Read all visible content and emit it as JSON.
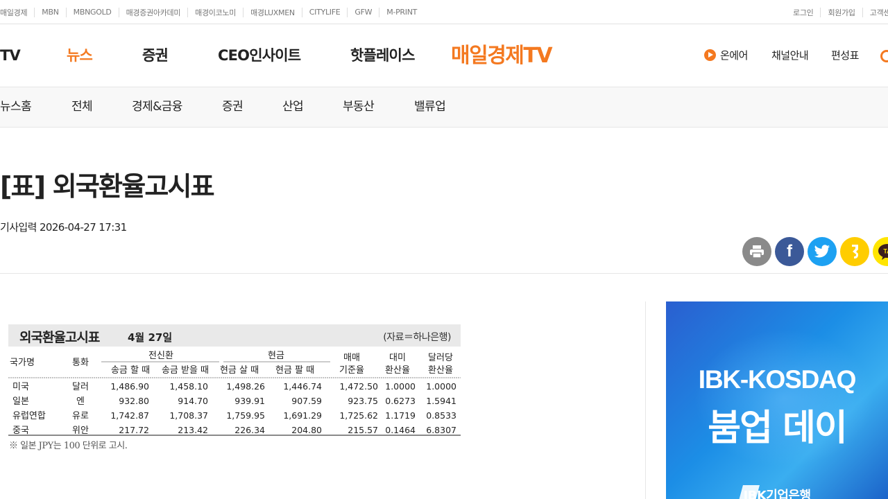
{
  "utilbar": {
    "left_links": [
      "매일경제",
      "MBN",
      "MBNGOLD",
      "매경증권아카데미",
      "매경이코노미",
      "매경LUXMEN",
      "CITYLIFE",
      "GFW",
      "M-PRINT"
    ],
    "right_links": [
      "로그인",
      "회원가입",
      "고객센터"
    ]
  },
  "header": {
    "nav": [
      "TV",
      "뉴스",
      "증권",
      "CEO인사이트",
      "핫플레이스"
    ],
    "active_nav": "뉴스",
    "logo": "매일경제TV",
    "onair": "온에어",
    "channel": "채널안내",
    "schedule": "편성표"
  },
  "subnav": [
    "뉴스홈",
    "전체",
    "경제&금융",
    "증권",
    "산업",
    "부동산",
    "밸류업"
  ],
  "article": {
    "title": "[표] 외국환율고시표",
    "date": "기사입력 2026-04-27 17:31"
  },
  "share": {
    "print_icon": "printer-icon",
    "facebook_icon": "facebook-icon",
    "twitter_icon": "twitter-icon",
    "kakaostory_icon": "kakaostory-icon",
    "kakaotalk_icon": "kakaotalk-icon",
    "talk_label": "TA"
  },
  "fx_table": {
    "title": "외국환율고시표",
    "date": "4월 27일",
    "source": "(자료＝하나은행)",
    "group_headers": {
      "telegraphic": "전신환",
      "cash": "현금"
    },
    "headers": [
      "국가명",
      "통화",
      "송금 할 때",
      "송금 받을 때",
      "현금 살 때",
      "현금 팔 때",
      "매매 기준율",
      "대미 환산율",
      "달러당 환산율"
    ],
    "rows": [
      [
        "미국",
        "달러",
        "1,486.90",
        "1,458.10",
        "1,498.26",
        "1,446.74",
        "1,472.50",
        "1.0000",
        "1.0000"
      ],
      [
        "일본",
        "엔",
        "932.80",
        "914.70",
        "939.91",
        "907.59",
        "923.75",
        "0.6273",
        "1.5941"
      ],
      [
        "유럽연합",
        "유로",
        "1,742.87",
        "1,708.37",
        "1,759.95",
        "1,691.29",
        "1,725.62",
        "1.1719",
        "0.8533"
      ],
      [
        "중국",
        "위안",
        "217.72",
        "213.42",
        "226.34",
        "204.80",
        "215.57",
        "0.1464",
        "6.8307"
      ]
    ],
    "note": "※ 일본 JPY는 100 단위로 고시."
  },
  "ad": {
    "line1": "IBK-KOSDAQ",
    "line2": "붐업 데이",
    "brand": "IBK기업은행"
  },
  "colors": {
    "accent": "#f47920",
    "facebook": "#3b5998",
    "twitter": "#1da1f2",
    "kakao": "#ffcd00"
  }
}
